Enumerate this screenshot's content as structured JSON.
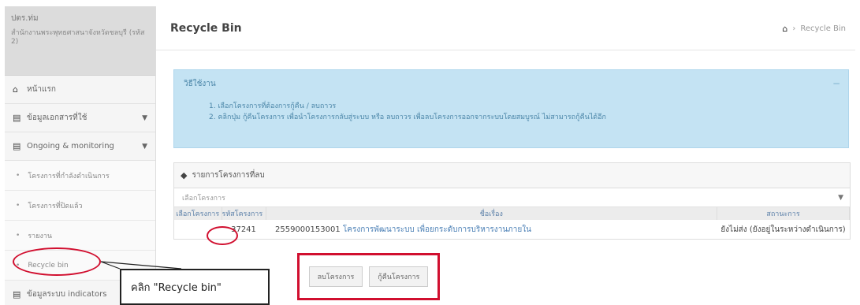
{
  "sidebar": {
    "org_label": "ปตร.ท่ม",
    "org_desc": "สำนักงานพระพุทธศาสนาจังหวัดชลบุรี (รหัส 2)",
    "items": [
      {
        "label": "หน้าแรก",
        "icon": "home-icon"
      },
      {
        "label": "ข้อมูลเอกสารที่ใช้",
        "icon": "list-icon",
        "expandable": true
      },
      {
        "label": "Ongoing & monitoring",
        "icon": "list-icon",
        "expandable": true
      }
    ],
    "sub_items": [
      {
        "label": "โครงการที่กำลังดำเนินการ"
      },
      {
        "label": "โครงการที่ปิดแล้ว"
      },
      {
        "label": "รายงาน"
      },
      {
        "label": "Recycle bin"
      }
    ],
    "bottom_item": {
      "label": "ข้อมูลระบบ indicators",
      "icon": "list-icon"
    }
  },
  "header": {
    "title": "Recycle Bin",
    "breadcrumb_current": "Recycle Bin"
  },
  "info": {
    "title": "วิธีใช้งาน",
    "lines": [
      "1. เลือกโครงการที่ต้องการกู้คืน / ลบถาวร",
      "2. คลิกปุ่ม กู้คืนโครงการ เพื่อนำโครงการกลับสู่ระบบ หรือ ลบถาวร เพื่อลบโครงการออกจากระบบโดยสมบูรณ์ ไม่สามารถกู้คืนได้อีก"
    ]
  },
  "panel": {
    "title": "รายการโครงการที่ลบ",
    "filter_placeholder": "เลือกโครงการ",
    "columns": [
      "เลือกโครงการ",
      "รหัสโครงการ",
      "ชื่อเรื่อง",
      "สถานะการ"
    ],
    "rows": [
      {
        "id": "37241",
        "code": "2559000153001",
        "name": "โครงการพัฒนาระบบ เพื่อยกระดับการบริหารงานภายใน",
        "status": "ยังไม่ส่ง (ยังอยู่ในระหว่างดำเนินการ)"
      }
    ]
  },
  "buttons": {
    "delete_label": "ลบโครงการ",
    "restore_label": "กู้คืนโครงการ"
  },
  "callout": {
    "text": "คลิก \"Recycle bin\""
  },
  "colors": {
    "highlight_red": "#d10f2f",
    "info_bg": "#c4e3f3",
    "link_blue": "#4a7fb5"
  }
}
